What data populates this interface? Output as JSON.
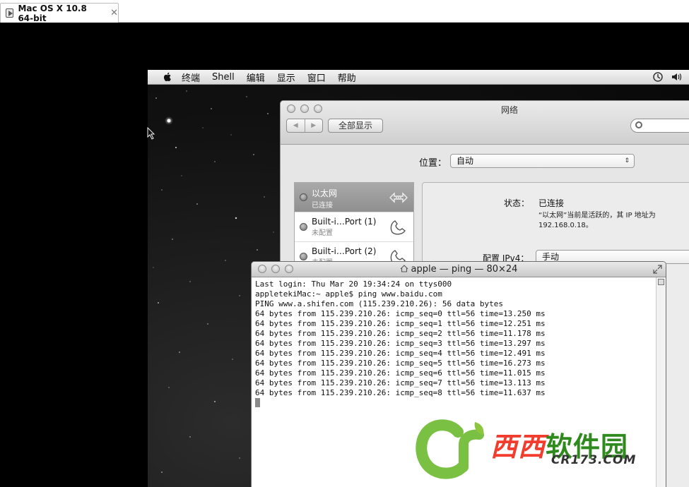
{
  "host": {
    "tab_title": "Mac OS X 10.8 64-bit",
    "tab_close": "✕",
    "tab_icon": "vm-icon"
  },
  "menubar": {
    "items": [
      "终端",
      "Shell",
      "编辑",
      "显示",
      "窗口",
      "帮助"
    ],
    "status_icons": [
      "time-machine-icon",
      "volume-icon"
    ]
  },
  "network": {
    "title": "网络",
    "nav_back": "◀",
    "nav_forward": "▶",
    "show_all": "全部显示",
    "location_label": "位置：",
    "location_value": "自动",
    "location_arrow": "⇕",
    "services": [
      {
        "name": "以太网",
        "status": "已连接"
      },
      {
        "name": "Built-i…Port (1)",
        "status": "未配置"
      },
      {
        "name": "Built-i…Port (2)",
        "status": "未配置"
      }
    ],
    "status_label": "状态：",
    "status_value": "已连接",
    "status_desc": "“以太网”当前是活跃的，其 IP 地址为 192.168.0.18。",
    "ipv4_label": "配置 IPv4：",
    "ipv4_value": "手动"
  },
  "terminal": {
    "title": "apple — ping — 80×24",
    "lines": [
      "Last login: Thu Mar 20 19:34:24 on ttys000",
      "appletekiMac:~ apple$ ping www.baidu.com",
      "PING www.a.shifen.com (115.239.210.26): 56 data bytes",
      "64 bytes from 115.239.210.26: icmp_seq=0 ttl=56 time=13.250 ms",
      "64 bytes from 115.239.210.26: icmp_seq=1 ttl=56 time=12.251 ms",
      "64 bytes from 115.239.210.26: icmp_seq=2 ttl=56 time=11.178 ms",
      "64 bytes from 115.239.210.26: icmp_seq=3 ttl=56 time=13.297 ms",
      "64 bytes from 115.239.210.26: icmp_seq=4 ttl=56 time=12.491 ms",
      "64 bytes from 115.239.210.26: icmp_seq=5 ttl=56 time=16.273 ms",
      "64 bytes from 115.239.210.26: icmp_seq=6 ttl=56 time=11.015 ms",
      "64 bytes from 115.239.210.26: icmp_seq=7 ttl=56 time=13.113 ms",
      "64 bytes from 115.239.210.26: icmp_seq=8 ttl=56 time=11.637 ms"
    ]
  },
  "watermark": {
    "chars_red": "西西",
    "chars_green": "软件园",
    "url": "CR173.COM"
  }
}
